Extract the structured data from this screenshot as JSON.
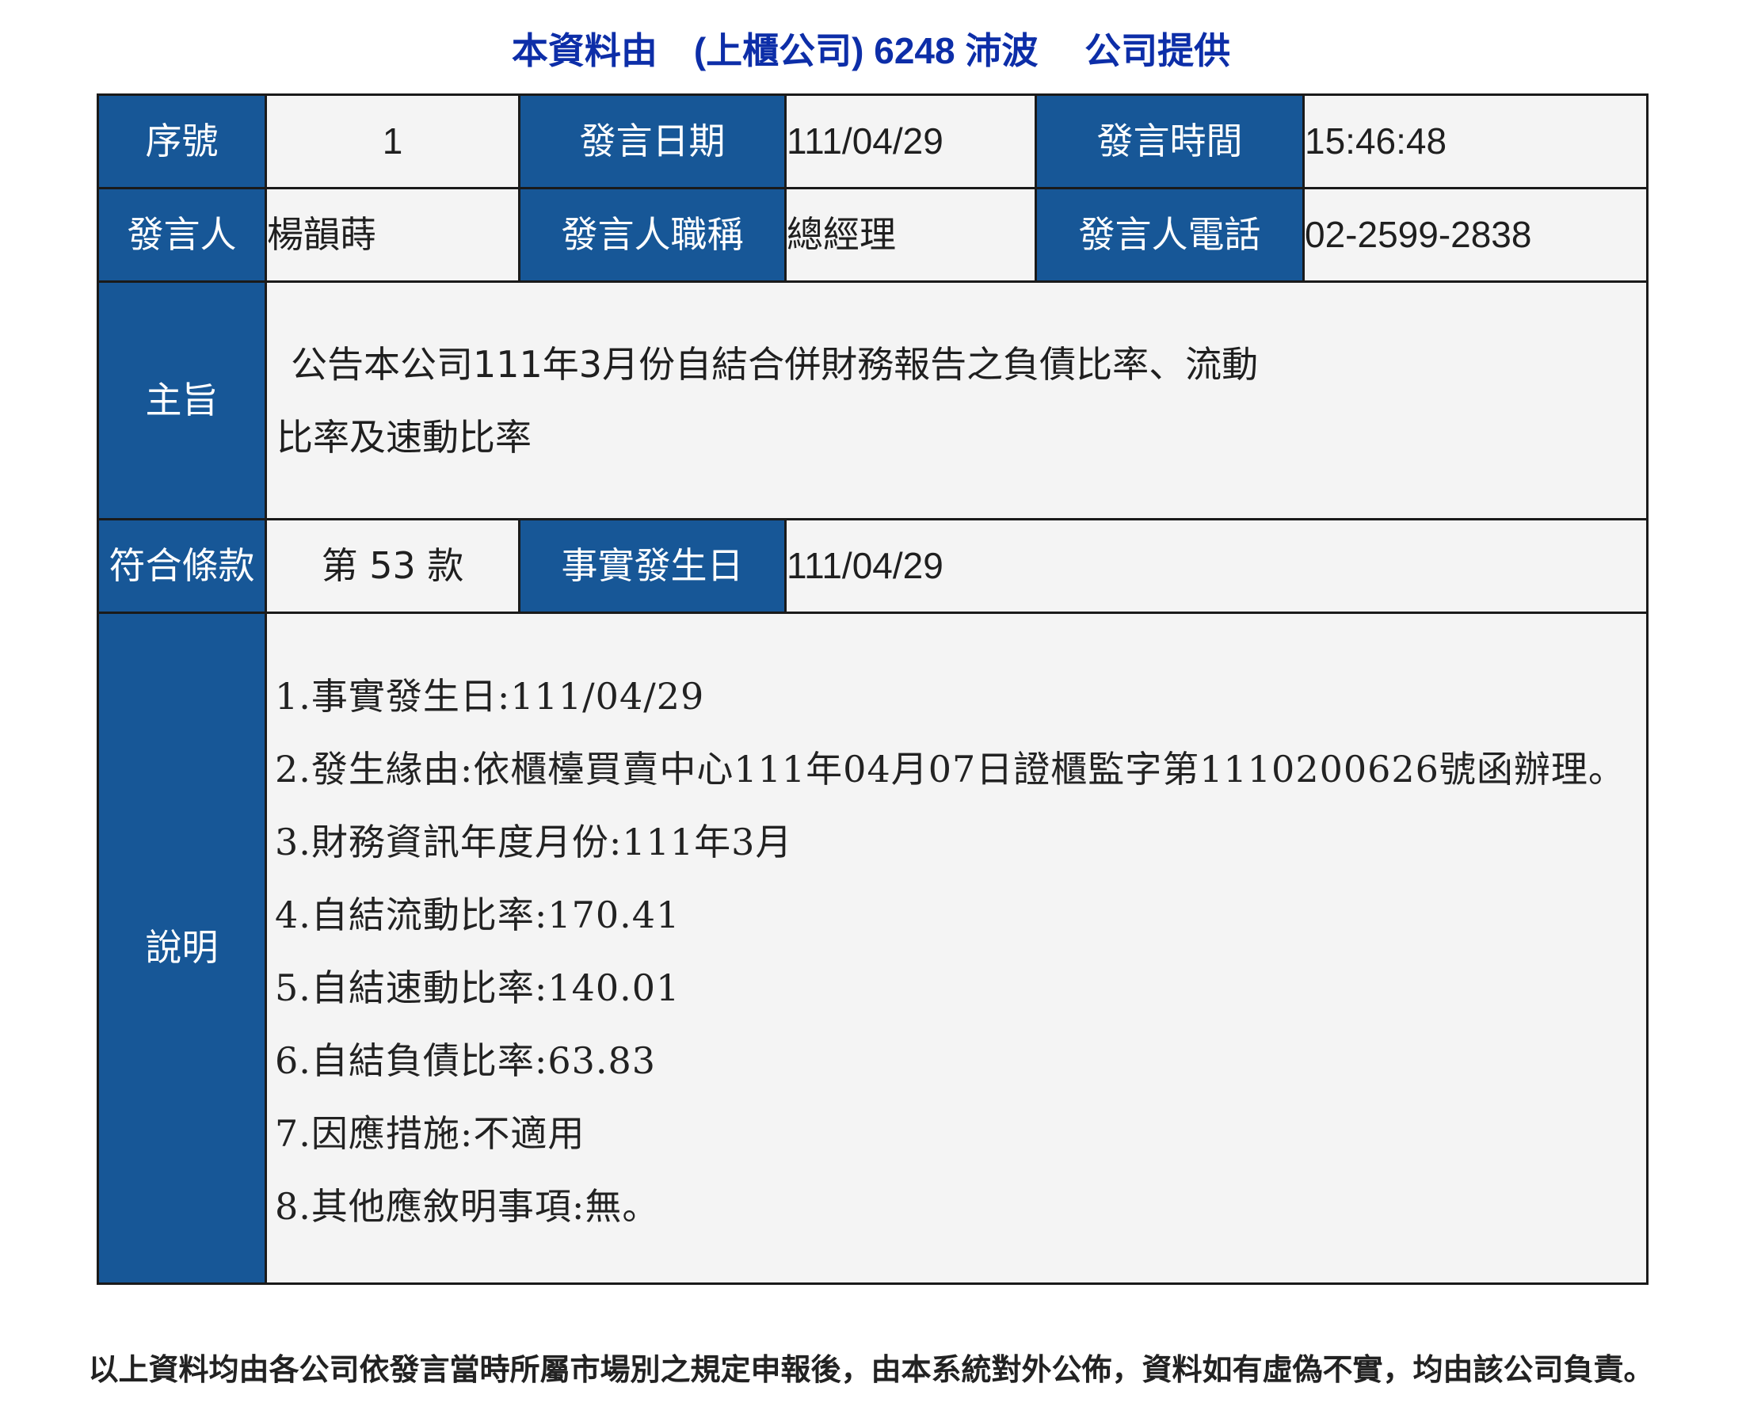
{
  "header": {
    "text": "本資料由　(上櫃公司) 6248 沛波　 公司提供"
  },
  "row1": {
    "serial_label": "序號",
    "serial_value": "1",
    "date_label": "發言日期",
    "date_value": "111/04/29",
    "time_label": "發言時間",
    "time_value": "15:46:48"
  },
  "row2": {
    "speaker_label": "發言人",
    "speaker_value": "楊韻蒔",
    "title_label": "發言人職稱",
    "title_value": "總經理",
    "phone_label": "發言人電話",
    "phone_value": "02-2599-2838"
  },
  "subject": {
    "label": "主旨",
    "lines": [
      "公告本公司111年3月份自結合併財務報告之負債比率、流動",
      "比率及速動比率"
    ]
  },
  "row4": {
    "clause_label": "符合條款",
    "clause_value": "第 53 款",
    "fact_date_label": "事實發生日",
    "fact_date_value": "111/04/29"
  },
  "description": {
    "label": "說明",
    "lines": [
      "1.事實發生日:111/04/29",
      "2.發生緣由:依櫃檯買賣中心111年04月07日證櫃監字第1110200626號函辦理。",
      "3.財務資訊年度月份:111年3月",
      "4.自結流動比率:170.41",
      "5.自結速動比率:140.01",
      "6.自結負債比率:63.83",
      "7.因應措施:不適用",
      "8.其他應敘明事項:無。"
    ]
  },
  "footer": {
    "text": "以上資料均由各公司依發言當時所屬市場別之規定申報後，由本系統對外公佈，資料如有虛偽不實，均由該公司負責。"
  },
  "colors": {
    "label_background": "#175797",
    "value_background": "#f4f4f4",
    "header_text": "#0d2ea8",
    "border": "#1a1a1a"
  }
}
